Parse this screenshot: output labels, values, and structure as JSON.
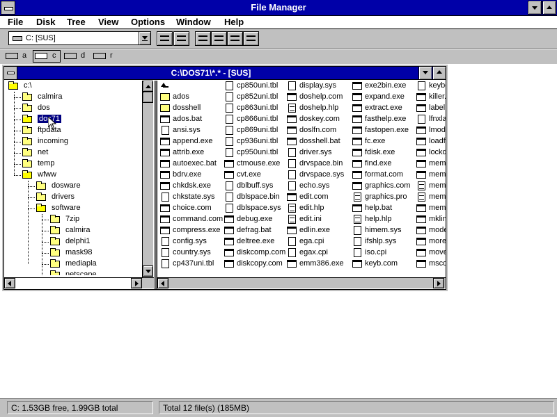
{
  "app": {
    "title": "File Manager"
  },
  "menu": [
    "File",
    "Disk",
    "Tree",
    "View",
    "Options",
    "Window",
    "Help"
  ],
  "toolbar": {
    "drive_selector": "C: [SUS]"
  },
  "drives": [
    {
      "letter": "a",
      "selected": false
    },
    {
      "letter": "c",
      "selected": true
    },
    {
      "letter": "d",
      "selected": false
    },
    {
      "letter": "r",
      "selected": false
    }
  ],
  "child_window": {
    "title": "C:\\DOS71\\*.* - [SUS]"
  },
  "tree": [
    {
      "label": "c:\\",
      "depth": 0
    },
    {
      "label": "calmira",
      "depth": 1
    },
    {
      "label": "dos",
      "depth": 1
    },
    {
      "label": "dos71",
      "depth": 1,
      "selected": true,
      "open": true
    },
    {
      "label": "ftpdata",
      "depth": 1
    },
    {
      "label": "incoming",
      "depth": 1
    },
    {
      "label": "net",
      "depth": 1
    },
    {
      "label": "temp",
      "depth": 1
    },
    {
      "label": "wfww",
      "depth": 1
    },
    {
      "label": "dosware",
      "depth": 2
    },
    {
      "label": "drivers",
      "depth": 2
    },
    {
      "label": "software",
      "depth": 2
    },
    {
      "label": "7zip",
      "depth": 3
    },
    {
      "label": "calmira",
      "depth": 3
    },
    {
      "label": "delphi1",
      "depth": 3
    },
    {
      "label": "mask98",
      "depth": 3
    },
    {
      "label": "mediapla",
      "depth": 3
    },
    {
      "label": "netscape",
      "depth": 3
    }
  ],
  "files": [
    [
      {
        "name": "",
        "icon": "up"
      },
      {
        "name": "ados",
        "icon": "folder"
      },
      {
        "name": "dosshell",
        "icon": "folder"
      },
      {
        "name": "ados.bat",
        "icon": "exe"
      },
      {
        "name": "ansi.sys",
        "icon": "file"
      },
      {
        "name": "append.exe",
        "icon": "exe"
      },
      {
        "name": "attrib.exe",
        "icon": "exe"
      },
      {
        "name": "autoexec.bat",
        "icon": "exe"
      },
      {
        "name": "bdrv.exe",
        "icon": "exe"
      },
      {
        "name": "chkdsk.exe",
        "icon": "exe"
      },
      {
        "name": "chkstate.sys",
        "icon": "file"
      },
      {
        "name": "choice.com",
        "icon": "exe"
      },
      {
        "name": "command.com",
        "icon": "exe"
      },
      {
        "name": "compress.exe",
        "icon": "exe"
      },
      {
        "name": "config.sys",
        "icon": "file"
      },
      {
        "name": "country.sys",
        "icon": "file"
      },
      {
        "name": "cp437uni.tbl",
        "icon": "file"
      }
    ],
    [
      {
        "name": "cp850uni.tbl",
        "icon": "file"
      },
      {
        "name": "cp852uni.tbl",
        "icon": "file"
      },
      {
        "name": "cp863uni.tbl",
        "icon": "file"
      },
      {
        "name": "cp866uni.tbl",
        "icon": "file"
      },
      {
        "name": "cp869uni.tbl",
        "icon": "file"
      },
      {
        "name": "cp936uni.tbl",
        "icon": "file"
      },
      {
        "name": "cp950uni.tbl",
        "icon": "file"
      },
      {
        "name": "ctmouse.exe",
        "icon": "exe"
      },
      {
        "name": "cvt.exe",
        "icon": "exe"
      },
      {
        "name": "dblbuff.sys",
        "icon": "file"
      },
      {
        "name": "dblspace.bin",
        "icon": "file"
      },
      {
        "name": "dblspace.sys",
        "icon": "file"
      },
      {
        "name": "debug.exe",
        "icon": "exe"
      },
      {
        "name": "defrag.bat",
        "icon": "exe"
      },
      {
        "name": "deltree.exe",
        "icon": "exe"
      },
      {
        "name": "diskcomp.com",
        "icon": "exe"
      },
      {
        "name": "diskcopy.com",
        "icon": "exe"
      }
    ],
    [
      {
        "name": "display.sys",
        "icon": "file"
      },
      {
        "name": "doshelp.com",
        "icon": "exe"
      },
      {
        "name": "doshelp.hlp",
        "icon": "doc"
      },
      {
        "name": "doskey.com",
        "icon": "exe"
      },
      {
        "name": "doslfn.com",
        "icon": "exe"
      },
      {
        "name": "dosshell.bat",
        "icon": "exe"
      },
      {
        "name": "driver.sys",
        "icon": "file"
      },
      {
        "name": "drvspace.bin",
        "icon": "file"
      },
      {
        "name": "drvspace.sys",
        "icon": "file"
      },
      {
        "name": "echo.sys",
        "icon": "file"
      },
      {
        "name": "edit.com",
        "icon": "exe"
      },
      {
        "name": "edit.hlp",
        "icon": "doc"
      },
      {
        "name": "edit.ini",
        "icon": "doc"
      },
      {
        "name": "edlin.exe",
        "icon": "exe"
      },
      {
        "name": "ega.cpi",
        "icon": "file"
      },
      {
        "name": "egax.cpi",
        "icon": "file"
      },
      {
        "name": "emm386.exe",
        "icon": "exe"
      }
    ],
    [
      {
        "name": "exe2bin.exe",
        "icon": "exe"
      },
      {
        "name": "expand.exe",
        "icon": "exe"
      },
      {
        "name": "extract.exe",
        "icon": "exe"
      },
      {
        "name": "fasthelp.exe",
        "icon": "exe"
      },
      {
        "name": "fastopen.exe",
        "icon": "exe"
      },
      {
        "name": "fc.exe",
        "icon": "exe"
      },
      {
        "name": "fdisk.exe",
        "icon": "exe"
      },
      {
        "name": "find.exe",
        "icon": "exe"
      },
      {
        "name": "format.com",
        "icon": "exe"
      },
      {
        "name": "graphics.com",
        "icon": "exe"
      },
      {
        "name": "graphics.pro",
        "icon": "doc"
      },
      {
        "name": "help.bat",
        "icon": "exe"
      },
      {
        "name": "help.hlp",
        "icon": "doc"
      },
      {
        "name": "himem.sys",
        "icon": "file"
      },
      {
        "name": "ifshlp.sys",
        "icon": "file"
      },
      {
        "name": "iso.cpi",
        "icon": "file"
      },
      {
        "name": "keyb.com",
        "icon": "exe"
      }
    ],
    [
      {
        "name": "keybo",
        "icon": "file"
      },
      {
        "name": "killer.",
        "icon": "exe"
      },
      {
        "name": "label.",
        "icon": "exe"
      },
      {
        "name": "lfnxlat",
        "icon": "file"
      },
      {
        "name": "lmod.",
        "icon": "exe"
      },
      {
        "name": "loadfi",
        "icon": "exe"
      },
      {
        "name": "lockd",
        "icon": "exe"
      },
      {
        "name": "mem.",
        "icon": "exe"
      },
      {
        "name": "memm",
        "icon": "exe"
      },
      {
        "name": "memm",
        "icon": "doc"
      },
      {
        "name": "memm",
        "icon": "doc"
      },
      {
        "name": "memm",
        "icon": "exe"
      },
      {
        "name": "mklink",
        "icon": "exe"
      },
      {
        "name": "mode",
        "icon": "exe"
      },
      {
        "name": "more.",
        "icon": "exe"
      },
      {
        "name": "move",
        "icon": "exe"
      },
      {
        "name": "mscd",
        "icon": "exe"
      }
    ]
  ],
  "status": {
    "disk": "C: 1.53GB free,  1.99GB total",
    "total": "Total 12 file(s) (185MB)"
  }
}
